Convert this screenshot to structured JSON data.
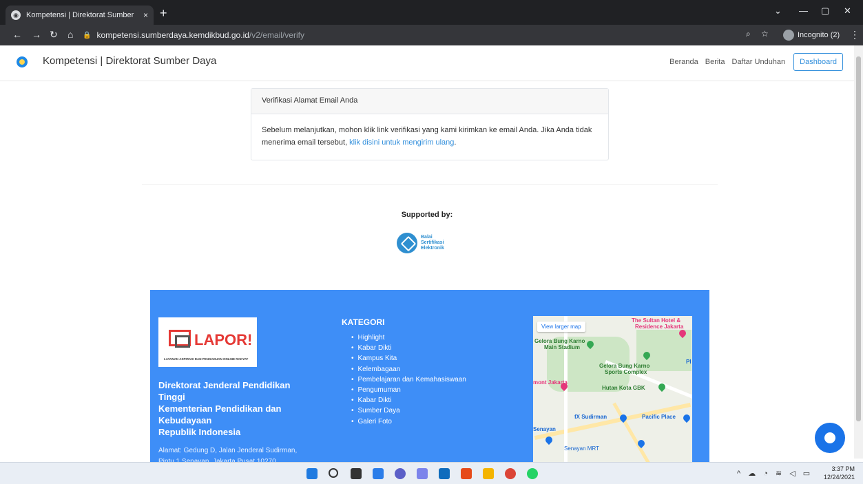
{
  "browser": {
    "tab_title": "Kompetensi | Direktorat Sumber",
    "tab_close": "×",
    "new_tab": "+",
    "url_host": "kompetensi.sumberdaya.kemdikbud.go.id",
    "url_path": "/v2/email/verify",
    "incognito_label": "Incognito (2)"
  },
  "navbar": {
    "brand": "Kompetensi | Direktorat Sumber Daya",
    "links": [
      "Beranda",
      "Berita",
      "Daftar Unduhan"
    ],
    "dashboard": "Dashboard"
  },
  "card": {
    "header": "Verifikasi Alamat Email Anda",
    "body": "Sebelum melanjutkan, mohon klik link verifikasi yang kami kirimkan ke email Anda. Jika Anda tidak menerima email tersebut,",
    "link": "klik disini untuk mengirim ulang",
    "end": "."
  },
  "supported": {
    "label": "Supported by:",
    "logo_lines": [
      "Balai",
      "Sertifikasi",
      "Elektronik"
    ]
  },
  "footer": {
    "lapor_word": "LAPOR!",
    "lapor_sub": "LAYANAN ASPIRASI DAN PENGADUAN ONLINE RAKYAT",
    "org_lines": [
      "Direktorat Jenderal Pendidikan",
      "Tinggi",
      "Kementerian Pendidikan dan",
      "Kebudayaan",
      "Republik Indonesia"
    ],
    "address_lines": [
      "Alamat: Gedung D, Jalan Jenderal Sudirman,",
      "Pintu 1 Senayan, Jakarta Pusat 10270"
    ],
    "kategori_title": "KATEGORI",
    "kategori": [
      "Highlight",
      "Kabar Dikti",
      "Kampus Kita",
      "Kelembagaan",
      "Pembelajaran dan Kemahasiswaan",
      "Pengumuman",
      "Kabar Dikti",
      "Sumber Daya",
      "Galeri Foto"
    ],
    "map": {
      "view_larger": "View larger map",
      "labels": [
        "The Sultan Hotel &",
        "Residence Jakarta",
        "Gelora Bung Karno",
        "Main Stadium",
        "Gelora Bung Karno",
        "Sports Complex",
        "mont Jakarta",
        "Hutan Kota GBK",
        "fX Sudirman",
        "Pacific Place",
        "Senayan",
        "Senayan MRT",
        "PI"
      ]
    }
  },
  "taskbar": {
    "time": "3:37 PM",
    "date": "12/24/2021"
  }
}
